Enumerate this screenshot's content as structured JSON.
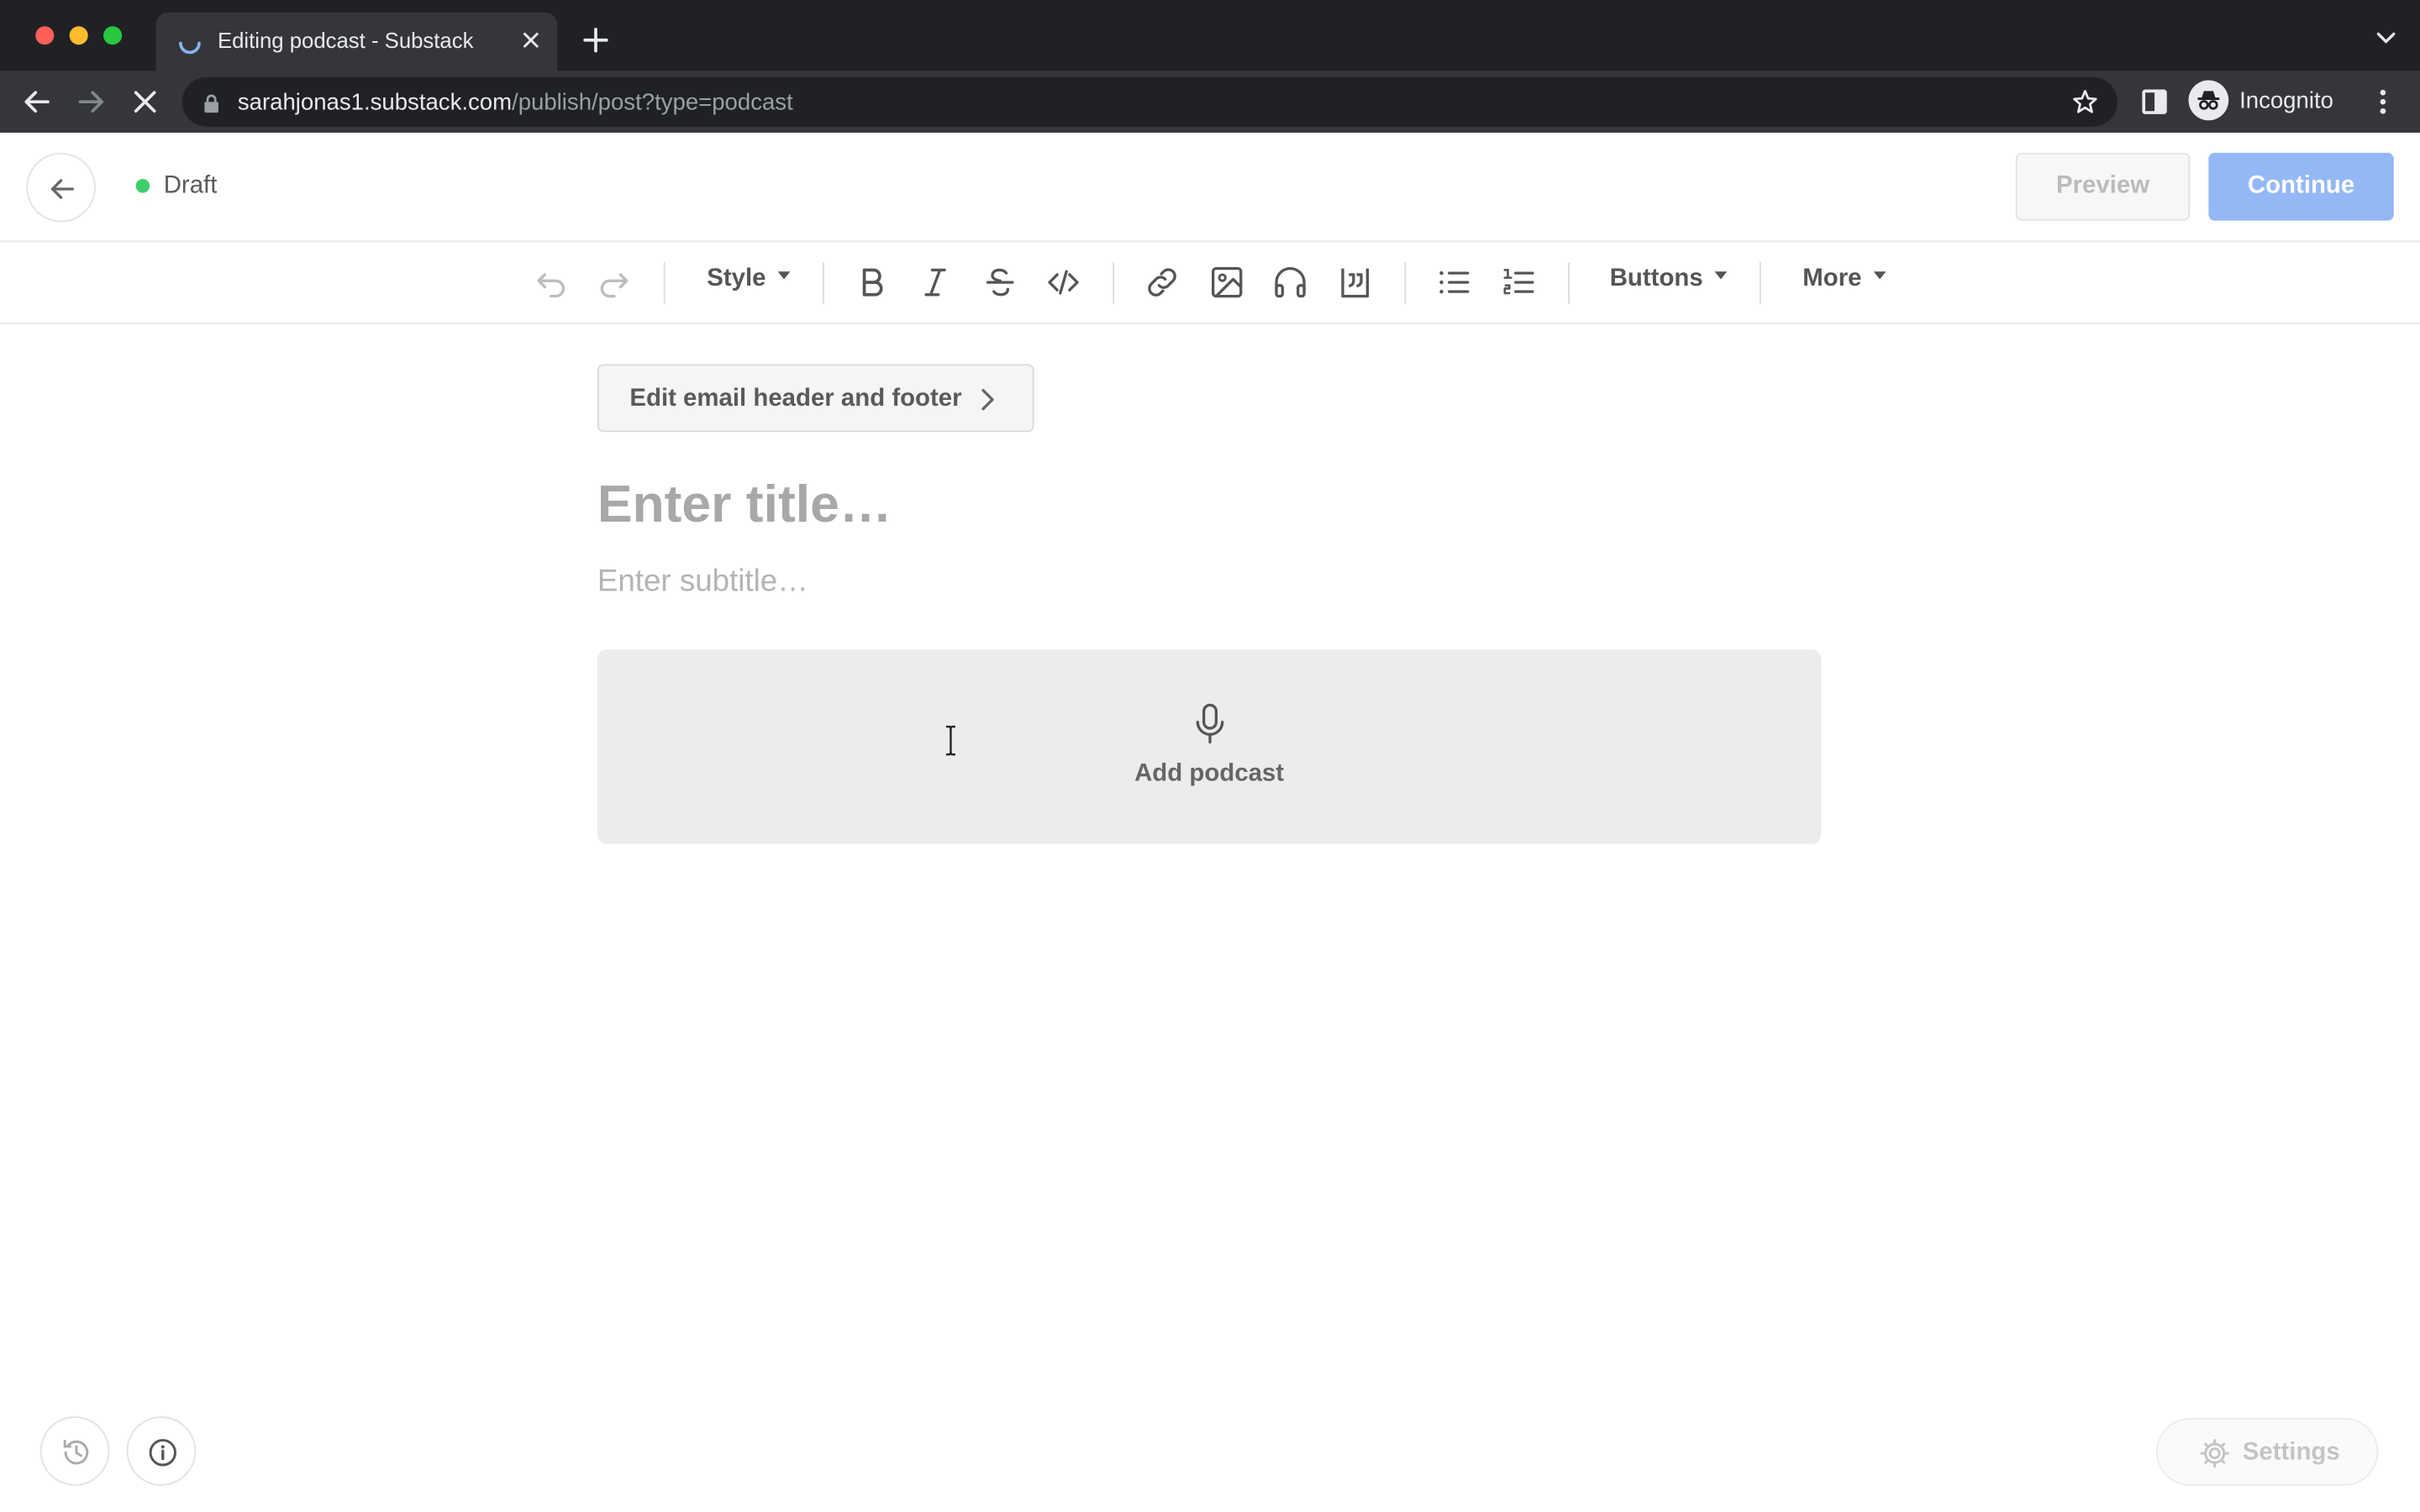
{
  "browser": {
    "tab_title": "Editing podcast - Substack",
    "url_host": "sarahjonas1.substack.com",
    "url_path": "/publish/post?type=podcast",
    "profile_label": "Incognito"
  },
  "header": {
    "status_label": "Draft",
    "status_color": "#3ecf6b",
    "preview_label": "Preview",
    "continue_label": "Continue",
    "accent_color": "#94b8f6"
  },
  "editor_toolbar": {
    "style_label": "Style",
    "buttons_label": "Buttons",
    "more_label": "More",
    "icons": [
      "undo-icon",
      "redo-icon",
      "bold-icon",
      "italic-icon",
      "strikethrough-icon",
      "code-icon",
      "link-icon",
      "image-icon",
      "audio-icon",
      "quote-icon",
      "bullet-list-icon",
      "numbered-list-icon"
    ]
  },
  "content": {
    "email_header_button": "Edit email header and footer",
    "title_placeholder": "Enter title…",
    "subtitle_placeholder": "Enter subtitle…",
    "add_podcast_label": "Add podcast"
  },
  "footer": {
    "settings_label": "Settings"
  }
}
